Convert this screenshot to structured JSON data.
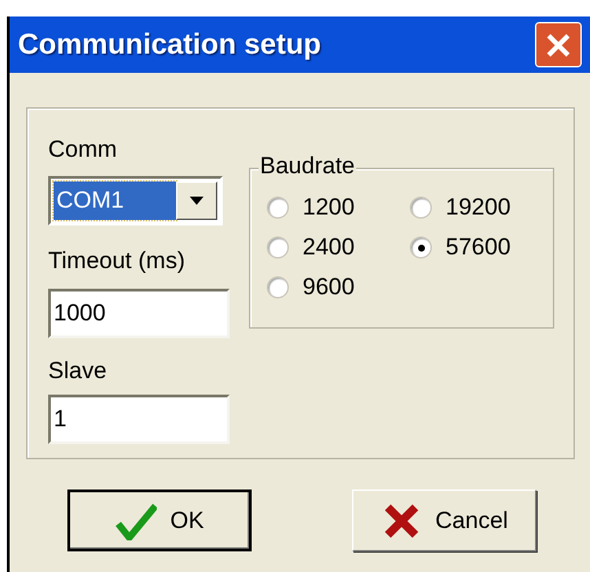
{
  "window": {
    "title": "Communication setup"
  },
  "comm": {
    "label": "Comm",
    "value": "COM1"
  },
  "timeout": {
    "label": "Timeout (ms)",
    "value": "1000"
  },
  "slave": {
    "label": "Slave",
    "value": "1"
  },
  "baudrate": {
    "label": "Baudrate",
    "options": [
      {
        "label": "1200",
        "selected": false
      },
      {
        "label": "19200",
        "selected": false
      },
      {
        "label": "2400",
        "selected": false
      },
      {
        "label": "57600",
        "selected": true
      },
      {
        "label": "9600",
        "selected": false
      }
    ]
  },
  "buttons": [
    {
      "kind": "ok",
      "label": "OK",
      "default": true
    },
    {
      "kind": "cancel",
      "label": "Cancel",
      "default": false
    }
  ]
}
